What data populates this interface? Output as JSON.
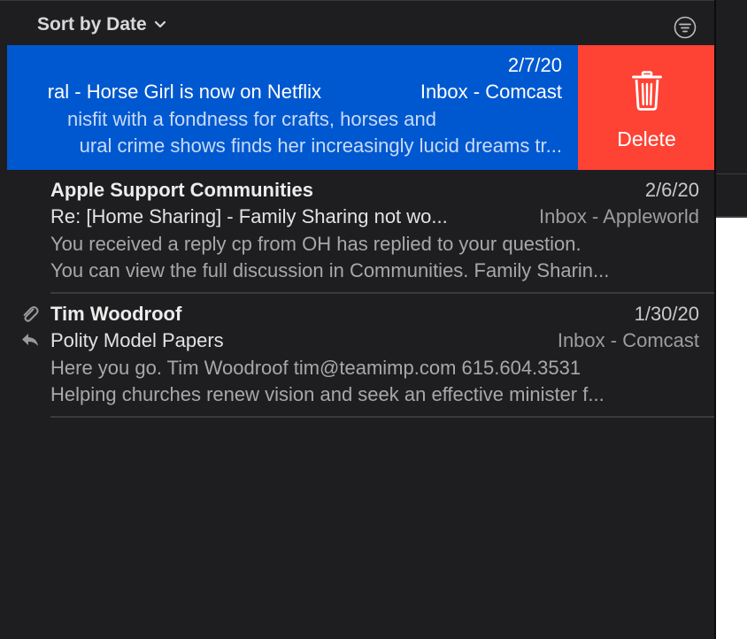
{
  "toolbar": {
    "sort_label": "Sort by Date",
    "sort_icon": "chevron-down-icon",
    "filter_icon": "filter-icon"
  },
  "colors": {
    "selected": "#0058d0",
    "delete": "#fe4234",
    "background": "#1e1e20"
  },
  "messages": [
    {
      "date": "2/7/20",
      "subject": "ral - Horse Girl is now on Netflix",
      "mailbox": "Inbox - Comcast",
      "preview_1": "nisfit with a fondness for crafts, horses and",
      "preview_2": "ural crime shows finds her increasingly lucid dreams tr...",
      "swipe_action": "Delete",
      "swipe_icon": "trash-icon"
    },
    {
      "sender": "Apple Support Communities",
      "date": "2/6/20",
      "subject": "Re:  [Home Sharing] - Family Sharing not wo...",
      "mailbox": "Inbox - Appleworld",
      "preview_1": "You received a reply cp from OH has replied to your question.",
      "preview_2": "You can view the full discussion in Communities. Family Sharin..."
    },
    {
      "sender": "Tim Woodroof",
      "date": "1/30/20",
      "subject": "Polity Model Papers",
      "mailbox": "Inbox - Comcast",
      "preview_1": "Here you go. Tim Woodroof tim@teamimp.com 615.604.3531",
      "preview_2": "Helping churches renew vision and seek an effective minister f...",
      "icons": [
        "paperclip-icon",
        "reply-icon"
      ]
    }
  ]
}
